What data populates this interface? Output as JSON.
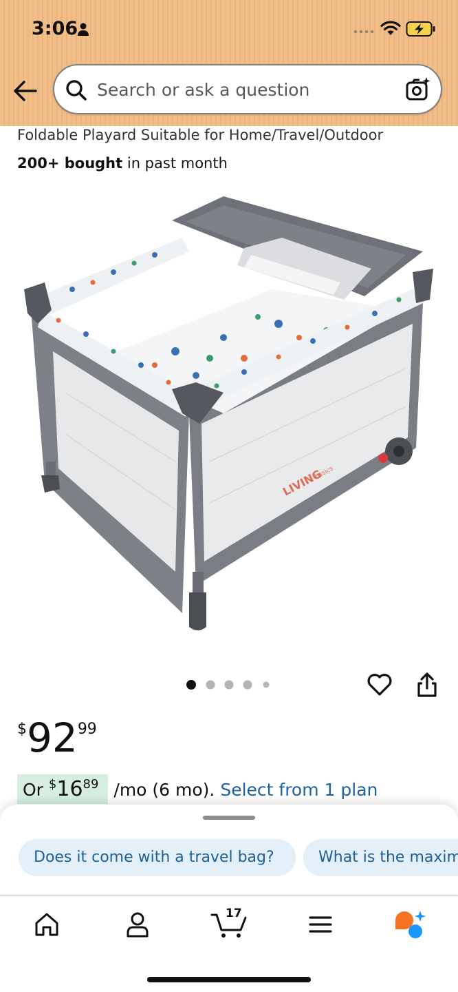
{
  "status_bar": {
    "time": "3:06",
    "icons": [
      "person-icon",
      "signal-dots-icon",
      "wifi-icon",
      "battery-charging-icon"
    ]
  },
  "header": {
    "back_icon": "arrow-left-icon",
    "search": {
      "placeholder": "Search or ask a question",
      "value": "",
      "icon": "search-icon",
      "camera_icon": "camera-sparkle-icon"
    },
    "background_color": "#f1bd88"
  },
  "product": {
    "title": "Foldable Playard Suitable for Home/Travel/Outdoor",
    "bought_bold": "200+ bought",
    "bought_rest": " in past month",
    "image_alt": "Foldable playard with changing table",
    "image_brand_text": "LIVING basics",
    "carousel": {
      "count": 5,
      "active_index": 0
    },
    "actions": [
      "heart-icon",
      "share-icon"
    ],
    "price": {
      "symbol": "$",
      "whole": "92",
      "fraction": "99"
    },
    "installment": {
      "prefix": "Or ",
      "symbol": "$",
      "whole": "16",
      "fraction": "89",
      "suffix": " /mo (6 mo). ",
      "link": "Select from 1 plan",
      "badge_color": "#d5eee0",
      "link_color": "#2162a1"
    }
  },
  "suggestions": {
    "chips": [
      "Does it come with a travel bag?",
      "What is the maximum weight"
    ],
    "chip_color": "#e3f0fa"
  },
  "nav": {
    "items": [
      "home-icon",
      "account-icon",
      "cart-icon",
      "menu-icon",
      "rufus-icon"
    ],
    "cart_count": "17",
    "rufus_colors": [
      "#f5731f",
      "#1a98ff"
    ]
  }
}
